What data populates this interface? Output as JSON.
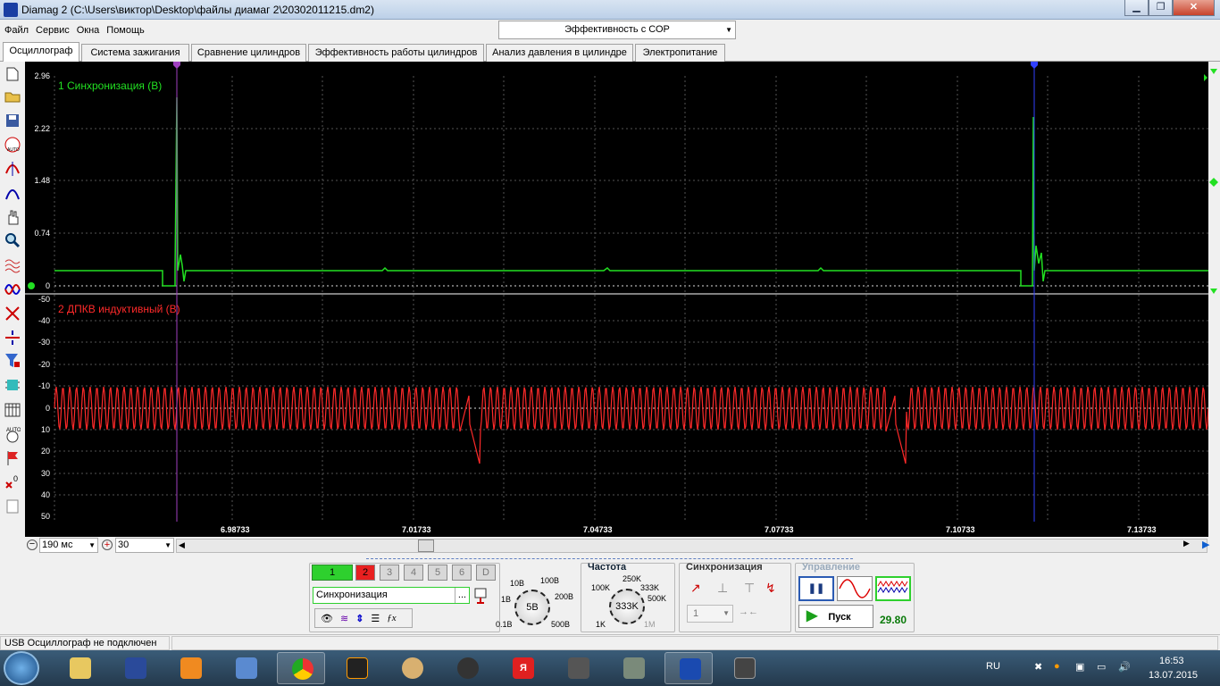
{
  "window": {
    "title": "Diamag 2 (C:\\Users\\виктор\\Desktop\\файлы диамаг 2\\20302011215.dm2)"
  },
  "menu": [
    "Файл",
    "Сервис",
    "Окна",
    "Помощь"
  ],
  "preset_combo": {
    "value": "Эффективность с СОР"
  },
  "tabs": [
    "Осциллограф",
    "Система зажигания",
    "Сравнение цилиндров",
    "Эффективность работы цилиндров",
    "Анализ давления в цилиндре",
    "Электропитание"
  ],
  "scope": {
    "channel1": {
      "label": "1 Синхронизация (В)",
      "color": "#22e022",
      "y_ticks": [
        "2.96",
        "2.22",
        "1.48",
        "0.74",
        "0"
      ]
    },
    "channel2": {
      "label": "2 ДПКВ индуктивный (В)",
      "color": "#ff2a2a",
      "y_ticks": [
        "-50",
        "-40",
        "-30",
        "-20",
        "-10",
        "0",
        "10",
        "20",
        "30",
        "40",
        "50"
      ]
    },
    "x_ticks": [
      "6.98733",
      "7.01733",
      "7.04733",
      "7.07733",
      "7.10733",
      "7.13733"
    ],
    "cursors": [
      {
        "label": "1",
        "color": "#a040c0"
      },
      {
        "label": "2",
        "color": "#3040ff"
      }
    ]
  },
  "timebase": {
    "value": "190 мс",
    "zoom": "30"
  },
  "channels": {
    "buttons": [
      "1",
      "2",
      "3",
      "4",
      "5",
      "6",
      "D"
    ],
    "sensor": "Синхронизация",
    "sensor_btn": "..."
  },
  "voltage_knob": {
    "labels": [
      "10В",
      "100В",
      "1В",
      "200В",
      "0.1В",
      "500В"
    ],
    "value": "5В"
  },
  "freq": {
    "title": "Частота",
    "labels": [
      "250K",
      "100K",
      "333K",
      "500K",
      "1K",
      "1M"
    ],
    "value": "333K"
  },
  "sync": {
    "title": "Синхронизация",
    "channel": "1"
  },
  "control": {
    "title": "Управление",
    "start_label": "Пуск",
    "value": "29.80"
  },
  "status": {
    "text": "USB Осциллограф не подключен"
  },
  "taskbar": {
    "lang": "RU",
    "time": "16:53",
    "date": "13.07.2015"
  },
  "colors": {
    "green": "#22e022",
    "red": "#ff2a2a",
    "grid": "#555555"
  }
}
